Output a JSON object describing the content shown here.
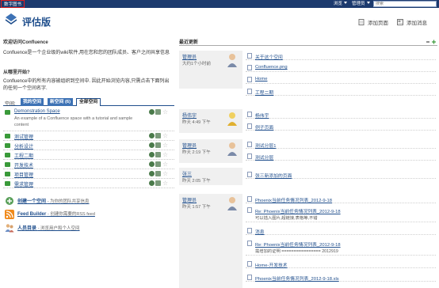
{
  "topbar": {
    "brand": "数字图书",
    "nav_browse": "浏览",
    "nav_admin": "管理员",
    "search_placeholder": "搜索"
  },
  "header": {
    "title": "评估版",
    "add_page": "添加页面",
    "add_news": "添加消息"
  },
  "welcome": {
    "title": "欢迎访问Confluence",
    "body": "Confluence是一个企业级的wiki软件,用在您和您的团队成员、客户之间共享信息",
    "where_title": "从哪里开始?",
    "where_body": "Confluence中的所有内容被组织到空间中. 因此开始浏览内容,只需点击下面列出的任何一个空间名字."
  },
  "space_tabs": {
    "label": "空间:",
    "tabs": [
      "我的空间",
      "新空间 (6)",
      "全部空间"
    ]
  },
  "spaces": [
    {
      "name": "Demonstration Space",
      "desc": "An example of a Confluence space with a tutorial and sample content"
    },
    {
      "name": "测试管理",
      "desc": ""
    },
    {
      "name": "分析设计",
      "desc": ""
    },
    {
      "name": "工程二期",
      "desc": ""
    },
    {
      "name": "开发技术",
      "desc": ""
    },
    {
      "name": "项目管理",
      "desc": ""
    },
    {
      "name": "需求管理",
      "desc": ""
    }
  ],
  "footer_links": [
    {
      "label": "创建一个空间",
      "desc": "- 为你的团队共享信息"
    },
    {
      "label": "Feed Builder",
      "desc": "- 创建你需要的RSS feed"
    },
    {
      "label": "人员目录",
      "desc": "- 浏览用户和个人空间"
    }
  ],
  "updates": {
    "title": "最近更新",
    "groups": [
      {
        "user": "管理员",
        "time": "大约1个小时前",
        "items": [
          {
            "title": "关于这个空间",
            "sub": ""
          },
          {
            "title": "Confluence.png",
            "sub": ""
          },
          {
            "title": "Home",
            "sub": ""
          },
          {
            "title": "工程二期",
            "sub": ""
          }
        ]
      },
      {
        "user": "杨伟宇",
        "time": "昨天 4:49 下午",
        "items": [
          {
            "title": "杨伟宇",
            "sub": ""
          },
          {
            "title": "例子页面",
            "sub": ""
          }
        ]
      },
      {
        "user": "管理员",
        "time": "昨天 2:19 下午",
        "items": [
          {
            "title": "测试分层1",
            "sub": ""
          },
          {
            "title": "测试分层",
            "sub": ""
          }
        ]
      },
      {
        "user": "张三",
        "time": "昨天 2:05 下午",
        "items": [
          {
            "title": "张三新添加的页面",
            "sub": ""
          }
        ]
      },
      {
        "user": "管理员",
        "time": "昨天 1:57 下午",
        "items": [
          {
            "title": "Phoenix当前任务情况列表_2012-9-18",
            "sub": ""
          },
          {
            "title": "Re: Phoenix当前任务情况列表_2012-9-18",
            "sub": "可以插入图片,超链接,表格等,不错"
          },
          {
            "title": "消息",
            "sub": ""
          },
          {
            "title": "Re: Phoenix当前任务情况列表_2012-9-18",
            "sub": "需增加的证明 ================ 2012919"
          },
          {
            "title": "Home-开发技术",
            "sub": ""
          },
          {
            "title": "Phoenix当前任务情况列表_2012-9-18.xls",
            "sub": ""
          }
        ]
      }
    ]
  },
  "colors": {
    "topbar": "#1c3a6e",
    "link": "#1f4e8c",
    "tab": "#3d72b5",
    "card": "#f0f0f0"
  }
}
